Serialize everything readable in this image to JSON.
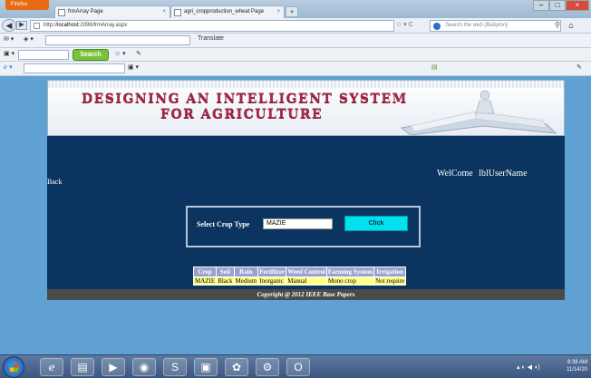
{
  "caption": "",
  "browser": {
    "firefox_menu": "Firefox",
    "tabs": [
      {
        "label": "frmArray Page"
      },
      {
        "label": "agri_cropproduction_wheat Page"
      }
    ],
    "new_tab": "+",
    "url_host": "localhost",
    "url_full_prefix": "http://",
    "url_rest": ":2096/frmArray.aspx",
    "search_placeholder": "Search the web (Babylon)"
  },
  "toolbars": {
    "translate_label": "Translate",
    "search_button": "Search"
  },
  "page": {
    "title_line1": "DESIGNING AN INTELLIGENT SYSTEM",
    "title_line2": "FOR AGRICULTURE",
    "welcome": "WelCome",
    "user_label": "lblUserName",
    "back_link": "Back",
    "select_label": "Select Crop Type",
    "crop_value": "MAZIE",
    "click_button": "Click",
    "table": {
      "headers": [
        "Crop",
        "Soil",
        "Rain",
        "Fertilizer",
        "Weed Control",
        "Farming System",
        "Irrigation"
      ],
      "rows": [
        [
          "MAZIE",
          "Black",
          "Medium",
          "Inorganic",
          "Manual",
          "Mono crop",
          "Not require"
        ]
      ]
    },
    "footer": "Copyright @ 2012 IEEE Base Papers"
  },
  "taskbar": {
    "time": "8:38 AM",
    "date": "11/14/20"
  }
}
